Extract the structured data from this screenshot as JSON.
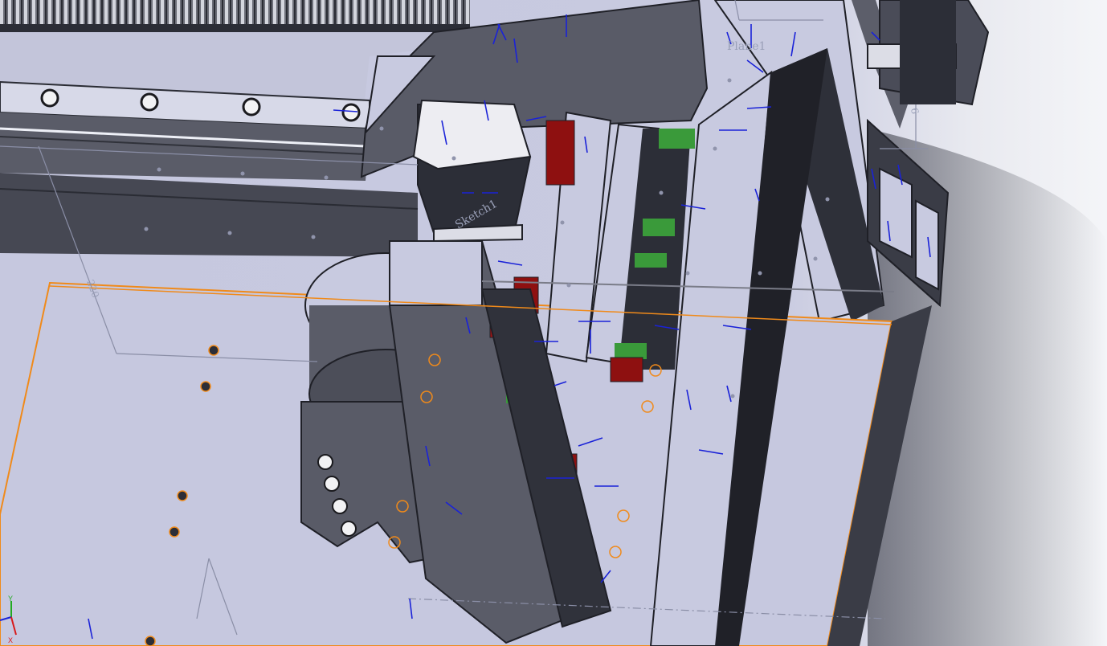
{
  "viewport": {
    "background": "#c8cae0",
    "accent_edge": "#f08a1a",
    "annotation_color": "#1a22d8"
  },
  "labels": {
    "plane_label": "Plane1",
    "sketch_label": "Sketch1",
    "dimension_220": "220",
    "dimension_6": "6"
  },
  "triad": {
    "x_label": "X",
    "y_label": "Y"
  }
}
